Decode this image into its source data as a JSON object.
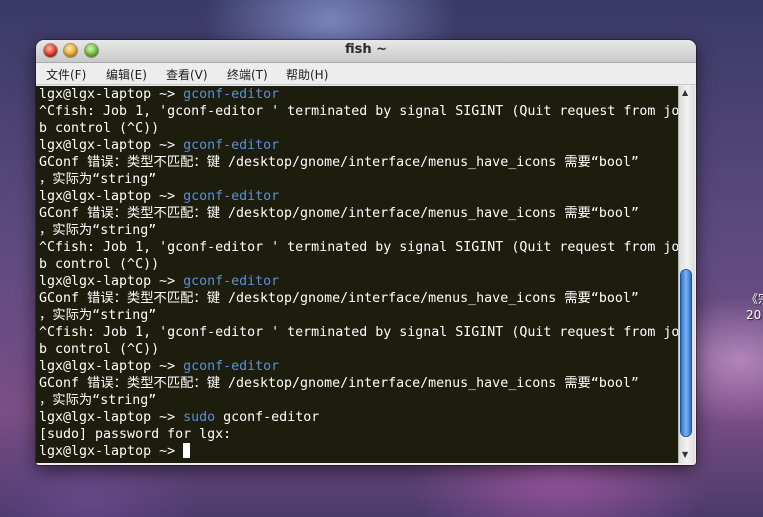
{
  "window": {
    "title": "fish  ~",
    "menu": [
      "文件(F)",
      "编辑(E)",
      "查看(V)",
      "终端(T)",
      "帮助(H)"
    ]
  },
  "terminal": {
    "prompt": "lgx@lgx-laptop ~> ",
    "lines": [
      {
        "type": "prompt",
        "cmd": "gconf-editor"
      },
      {
        "type": "text",
        "text": "^Cfish: Job 1, 'gconf-editor ' terminated by signal SIGINT (Quit request from jo"
      },
      {
        "type": "text",
        "text": "b control (^C))"
      },
      {
        "type": "prompt",
        "cmd": "gconf-editor"
      },
      {
        "type": "text",
        "text": "GConf 错误：类型不匹配：键 /desktop/gnome/interface/menus_have_icons 需要“bool”"
      },
      {
        "type": "text",
        "text": "，实际为“string”"
      },
      {
        "type": "prompt",
        "cmd": "gconf-editor"
      },
      {
        "type": "text",
        "text": "GConf 错误：类型不匹配：键 /desktop/gnome/interface/menus_have_icons 需要“bool”"
      },
      {
        "type": "text",
        "text": "，实际为“string”"
      },
      {
        "type": "text",
        "text": "^Cfish: Job 1, 'gconf-editor ' terminated by signal SIGINT (Quit request from jo"
      },
      {
        "type": "text",
        "text": "b control (^C))"
      },
      {
        "type": "prompt",
        "cmd": "gconf-editor"
      },
      {
        "type": "text",
        "text": "GConf 错误：类型不匹配：键 /desktop/gnome/interface/menus_have_icons 需要“bool”"
      },
      {
        "type": "text",
        "text": "，实际为“string”"
      },
      {
        "type": "text",
        "text": "^Cfish: Job 1, 'gconf-editor ' terminated by signal SIGINT (Quit request from jo"
      },
      {
        "type": "text",
        "text": "b control (^C))"
      },
      {
        "type": "prompt",
        "cmd": "gconf-editor"
      },
      {
        "type": "text",
        "text": "GConf 错误：类型不匹配：键 /desktop/gnome/interface/menus_have_icons 需要“bool”"
      },
      {
        "type": "text",
        "text": "，实际为“string”"
      },
      {
        "type": "prompt",
        "cmd": "sudo gconf-editor",
        "cmd_parts": [
          "sudo",
          " gconf-editor"
        ]
      },
      {
        "type": "text",
        "text": "[sudo] password for lgx:"
      },
      {
        "type": "prompt",
        "cmd": "",
        "cursor": true
      }
    ],
    "colors": {
      "background": "#1d1d0d",
      "foreground": "#ffffff",
      "command": "#5a8fd8"
    }
  },
  "desktop": {
    "text": "《宗\n20"
  },
  "icons": [
    "close-button",
    "minimize-button",
    "maximize-button",
    "scroll-up-arrow-icon",
    "scroll-down-arrow-icon"
  ]
}
